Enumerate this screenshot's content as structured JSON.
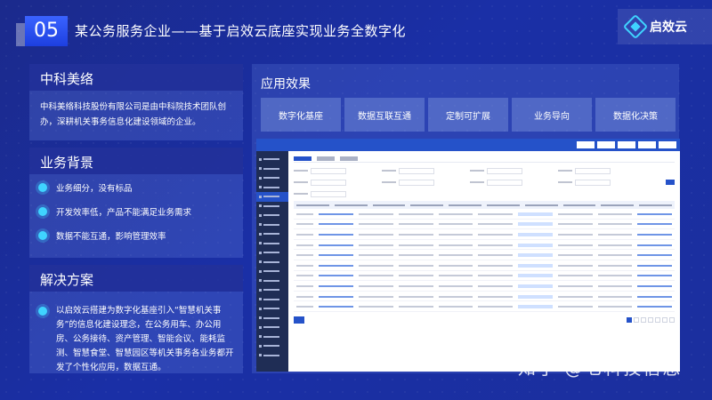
{
  "header": {
    "number": "05",
    "title": "某公务服务企业——基于启效云底座实现业务全数字化",
    "logo_text": "启效云"
  },
  "company": {
    "title": "中科美络",
    "description": "中科美络科技股份有限公司是由中科院技术团队创办，深耕机关事务信息化建设领域的企业。"
  },
  "background": {
    "title": "业务背景",
    "items": [
      "业务细分，没有标品",
      "开发效率低，产品不能满足业务需求",
      "数据不能互通，影响管理效率"
    ]
  },
  "solution": {
    "title": "解决方案",
    "text": "以启效云搭建为数字化基座引入“智慧机关事务”的信息化建设理念，在公务用车、办公用房、公务接待、资产管理、智能会议、能耗监测、智慧食堂、智慧园区等机关事务各业务都开发了个性化应用，数据互通。"
  },
  "effects": {
    "title": "应用效果",
    "tabs": [
      "数字化基座",
      "数据互联互通",
      "定制可扩展",
      "业务导向",
      "数据化决策"
    ]
  },
  "watermark": "知乎 @七科技信息"
}
